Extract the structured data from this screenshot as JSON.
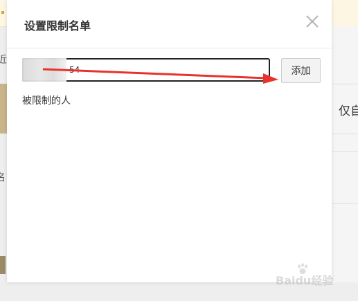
{
  "background": {
    "right_text": "仅自",
    "left_text_1": "近",
    "left_text_2": "名"
  },
  "dialog": {
    "title": "设置限制名单",
    "input_value": "54",
    "add_label": "添加",
    "restricted_label": "被限制的人"
  },
  "watermark": {
    "text": "Baidu经验"
  },
  "colors": {
    "arrow": "#e8322c",
    "top_banner": "#fdf6e3"
  },
  "icons": {
    "close": "close-icon",
    "watermark": "baidu-paw-icon"
  }
}
